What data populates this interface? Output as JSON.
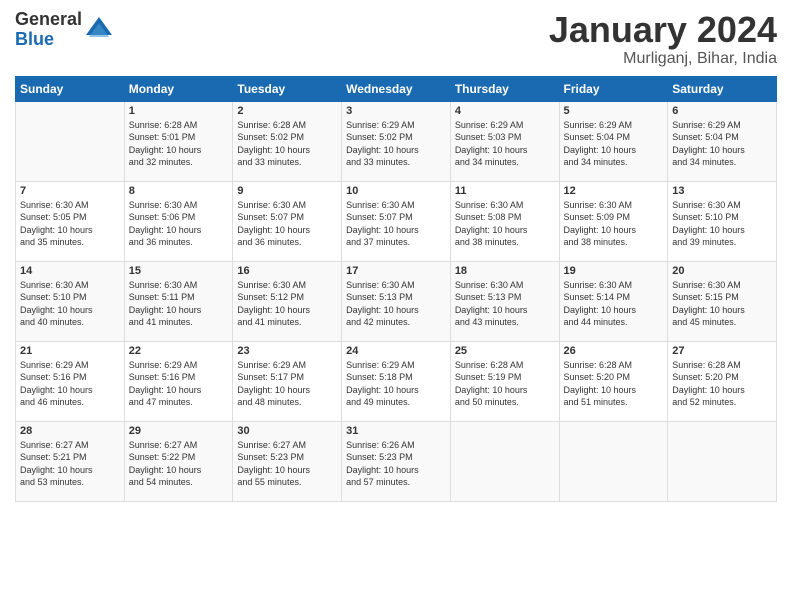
{
  "header": {
    "logo_general": "General",
    "logo_blue": "Blue",
    "month_title": "January 2024",
    "location": "Murliganj, Bihar, India"
  },
  "weekdays": [
    "Sunday",
    "Monday",
    "Tuesday",
    "Wednesday",
    "Thursday",
    "Friday",
    "Saturday"
  ],
  "weeks": [
    [
      {
        "day": "",
        "info": ""
      },
      {
        "day": "1",
        "info": "Sunrise: 6:28 AM\nSunset: 5:01 PM\nDaylight: 10 hours\nand 32 minutes."
      },
      {
        "day": "2",
        "info": "Sunrise: 6:28 AM\nSunset: 5:02 PM\nDaylight: 10 hours\nand 33 minutes."
      },
      {
        "day": "3",
        "info": "Sunrise: 6:29 AM\nSunset: 5:02 PM\nDaylight: 10 hours\nand 33 minutes."
      },
      {
        "day": "4",
        "info": "Sunrise: 6:29 AM\nSunset: 5:03 PM\nDaylight: 10 hours\nand 34 minutes."
      },
      {
        "day": "5",
        "info": "Sunrise: 6:29 AM\nSunset: 5:04 PM\nDaylight: 10 hours\nand 34 minutes."
      },
      {
        "day": "6",
        "info": "Sunrise: 6:29 AM\nSunset: 5:04 PM\nDaylight: 10 hours\nand 34 minutes."
      }
    ],
    [
      {
        "day": "7",
        "info": "Sunrise: 6:30 AM\nSunset: 5:05 PM\nDaylight: 10 hours\nand 35 minutes."
      },
      {
        "day": "8",
        "info": "Sunrise: 6:30 AM\nSunset: 5:06 PM\nDaylight: 10 hours\nand 36 minutes."
      },
      {
        "day": "9",
        "info": "Sunrise: 6:30 AM\nSunset: 5:07 PM\nDaylight: 10 hours\nand 36 minutes."
      },
      {
        "day": "10",
        "info": "Sunrise: 6:30 AM\nSunset: 5:07 PM\nDaylight: 10 hours\nand 37 minutes."
      },
      {
        "day": "11",
        "info": "Sunrise: 6:30 AM\nSunset: 5:08 PM\nDaylight: 10 hours\nand 38 minutes."
      },
      {
        "day": "12",
        "info": "Sunrise: 6:30 AM\nSunset: 5:09 PM\nDaylight: 10 hours\nand 38 minutes."
      },
      {
        "day": "13",
        "info": "Sunrise: 6:30 AM\nSunset: 5:10 PM\nDaylight: 10 hours\nand 39 minutes."
      }
    ],
    [
      {
        "day": "14",
        "info": "Sunrise: 6:30 AM\nSunset: 5:10 PM\nDaylight: 10 hours\nand 40 minutes."
      },
      {
        "day": "15",
        "info": "Sunrise: 6:30 AM\nSunset: 5:11 PM\nDaylight: 10 hours\nand 41 minutes."
      },
      {
        "day": "16",
        "info": "Sunrise: 6:30 AM\nSunset: 5:12 PM\nDaylight: 10 hours\nand 41 minutes."
      },
      {
        "day": "17",
        "info": "Sunrise: 6:30 AM\nSunset: 5:13 PM\nDaylight: 10 hours\nand 42 minutes."
      },
      {
        "day": "18",
        "info": "Sunrise: 6:30 AM\nSunset: 5:13 PM\nDaylight: 10 hours\nand 43 minutes."
      },
      {
        "day": "19",
        "info": "Sunrise: 6:30 AM\nSunset: 5:14 PM\nDaylight: 10 hours\nand 44 minutes."
      },
      {
        "day": "20",
        "info": "Sunrise: 6:30 AM\nSunset: 5:15 PM\nDaylight: 10 hours\nand 45 minutes."
      }
    ],
    [
      {
        "day": "21",
        "info": "Sunrise: 6:29 AM\nSunset: 5:16 PM\nDaylight: 10 hours\nand 46 minutes."
      },
      {
        "day": "22",
        "info": "Sunrise: 6:29 AM\nSunset: 5:16 PM\nDaylight: 10 hours\nand 47 minutes."
      },
      {
        "day": "23",
        "info": "Sunrise: 6:29 AM\nSunset: 5:17 PM\nDaylight: 10 hours\nand 48 minutes."
      },
      {
        "day": "24",
        "info": "Sunrise: 6:29 AM\nSunset: 5:18 PM\nDaylight: 10 hours\nand 49 minutes."
      },
      {
        "day": "25",
        "info": "Sunrise: 6:28 AM\nSunset: 5:19 PM\nDaylight: 10 hours\nand 50 minutes."
      },
      {
        "day": "26",
        "info": "Sunrise: 6:28 AM\nSunset: 5:20 PM\nDaylight: 10 hours\nand 51 minutes."
      },
      {
        "day": "27",
        "info": "Sunrise: 6:28 AM\nSunset: 5:20 PM\nDaylight: 10 hours\nand 52 minutes."
      }
    ],
    [
      {
        "day": "28",
        "info": "Sunrise: 6:27 AM\nSunset: 5:21 PM\nDaylight: 10 hours\nand 53 minutes."
      },
      {
        "day": "29",
        "info": "Sunrise: 6:27 AM\nSunset: 5:22 PM\nDaylight: 10 hours\nand 54 minutes."
      },
      {
        "day": "30",
        "info": "Sunrise: 6:27 AM\nSunset: 5:23 PM\nDaylight: 10 hours\nand 55 minutes."
      },
      {
        "day": "31",
        "info": "Sunrise: 6:26 AM\nSunset: 5:23 PM\nDaylight: 10 hours\nand 57 minutes."
      },
      {
        "day": "",
        "info": ""
      },
      {
        "day": "",
        "info": ""
      },
      {
        "day": "",
        "info": ""
      }
    ]
  ]
}
